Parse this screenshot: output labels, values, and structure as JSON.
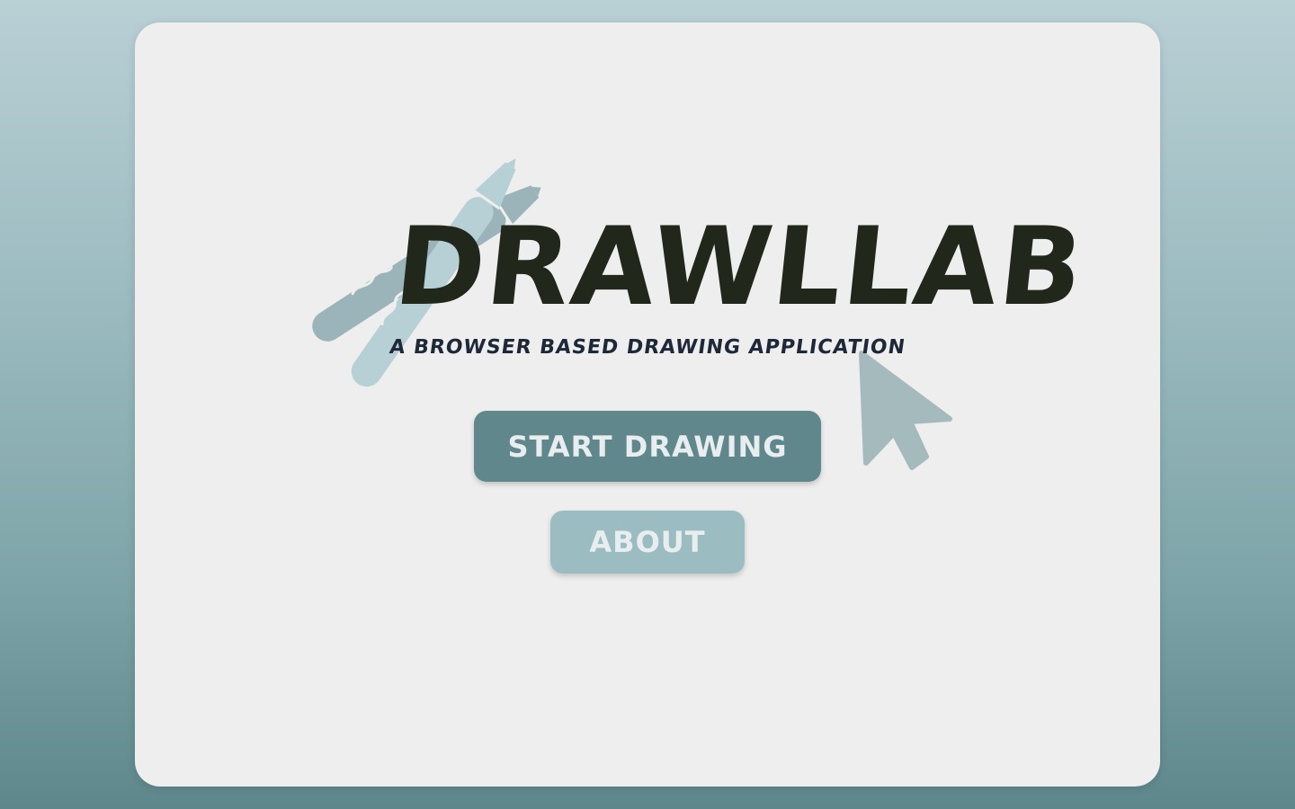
{
  "app": {
    "title": "DRAWLLAB",
    "subtitle": "A BROWSER BASED DRAWING APPLICATION"
  },
  "buttons": {
    "start_label": "START DRAWING",
    "about_label": "ABOUT"
  },
  "colors": {
    "background_top": "#b9d0d5",
    "background_bottom": "#5e878c",
    "card": "#eeeeee",
    "primary_button": "#60878c",
    "secondary_button": "#9bbdc1",
    "title_text": "#22271c",
    "subtitle_text": "#1f2838",
    "illustration_light": "#b7d0d6",
    "illustration_dark": "#9ab4b9",
    "cursor": "#a5babd"
  },
  "icons": {
    "pencils": "pencils-icon",
    "cursor": "cursor-arrow-icon"
  }
}
